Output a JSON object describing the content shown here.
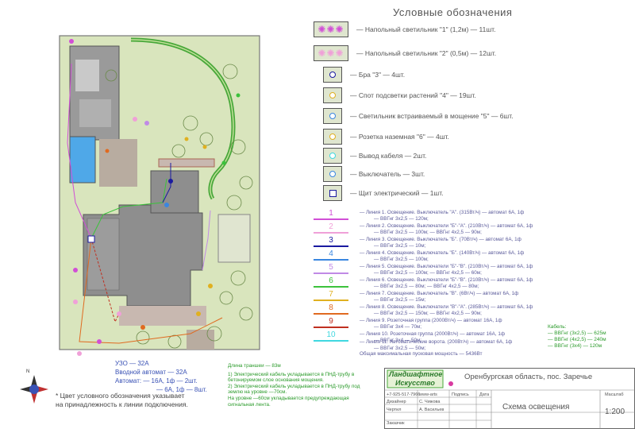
{
  "legend": {
    "title": "Условные обозначения",
    "items": [
      {
        "label": "— Напольный светильник \"1\" (1,2м) — 11шт.",
        "icon": "floor-lamp-1-icon"
      },
      {
        "label": "— Напольный светильник \"2\" (0,5м) — 12шт.",
        "icon": "floor-lamp-2-icon"
      },
      {
        "label": "— Бра \"3\" — 4шт.",
        "icon": "wall-lamp-icon"
      },
      {
        "label": "— Спот подсветки растений \"4\" — 19шт.",
        "icon": "plant-spot-icon"
      },
      {
        "label": "— Светильник встраиваемый в мощение \"5\" — 6шт.",
        "icon": "inground-lamp-icon"
      },
      {
        "label": "— Розетка наземная \"6\" — 4шт.",
        "icon": "ground-socket-icon"
      },
      {
        "label": "— Вывод кабеля — 2шт.",
        "icon": "cable-outlet-icon"
      },
      {
        "label": "— Выключатель — 3шт.",
        "icon": "switch-icon"
      },
      {
        "label": "— Щит электрический — 1шт.",
        "icon": "electric-panel-icon"
      }
    ]
  },
  "lines": [
    {
      "num": "1",
      "color": "#d14fd6",
      "l1": "— Линия 1. Освещение. Выключатель \"А\". (315Вт/ч) — автомат 6А, 1ф",
      "l2": "— ВВГнг 3х2,5 — 120м;"
    },
    {
      "num": "2",
      "color": "#f0a0d8",
      "l1": "— Линия 2. Освещение. Выключатели \"Б\"-\"А\". (210Вт/ч) — автомат 6А, 1ф",
      "l2": "— ВВГнг 3х2,5 — 100м; — ВВГнг 4х2,5 — 90м;"
    },
    {
      "num": "3",
      "color": "#1a1aa0",
      "l1": "— Линия 3. Освещение. Выключатель \"Б\". (70Вт/ч) — автомат 6А, 1ф",
      "l2": "— ВВГнг 3х2,5 — 10м;"
    },
    {
      "num": "4",
      "color": "#3a86e0",
      "l1": "— Линия 4. Освещение. Выключатель \"Б\". (140Вт/ч) — автомат 6А, 1ф",
      "l2": "— ВВГнг 3х2,5 — 100м;"
    },
    {
      "num": "5",
      "color": "#c08ae6",
      "l1": "— Линия 5. Освещение. Выключатели \"Б\"-\"В\". (210Вт/ч) — автомат 6А, 1ф",
      "l2": "— ВВГнг 3х2,5 — 100м; — ВВГнг 4х2,5 — 60м;"
    },
    {
      "num": "6",
      "color": "#3cc23c",
      "l1": "— Линия 6. Освещение. Выключатели \"Б\"-\"В\". (210Вт/ч) — автомат 6А, 1ф",
      "l2": "— ВВГнг 3х2,5 — 80м; — ВВГнг 4х2,5 — 80м;"
    },
    {
      "num": "7",
      "color": "#e0b020",
      "l1": "— Линия 7. Освещение. Выключатель \"В\". (6Вт/ч) — автомат 6А, 1ф",
      "l2": "— ВВГнг 3х2,5 — 15м;"
    },
    {
      "num": "8",
      "color": "#e06a20",
      "l1": "— Линия 8. Освещение. Выключатели \"В\"-\"А\". (285Вт/ч) — автомат 6А, 1ф",
      "l2": "— ВВГнг 3х2,5 — 150м; — ВВГнг 4х2,5 — 90м;"
    },
    {
      "num": "9",
      "color": "#c03020",
      "l1": "— Линия 9. Розеточная группа (2000Вт/ч) — автомат 16А, 1ф",
      "l2": "— ВВГнг 3х4 — 70м;"
    },
    {
      "num": "10",
      "color": "#40d8e0",
      "l1": "— Линия 10. Розеточная группа (2000Вт/ч) — автомат 16А, 1ф",
      "l2": "— ВВГнг 3х4 — 50м;"
    }
  ],
  "line11": "— Линия 11. Автоматические ворота. (200Вт/ч) — автомат 6А, 1ф",
  "line11b": "— ВВГнг 3х2,5 — 50м;",
  "total_power": "Общая максимальная пусковая мощность — 5436Вт",
  "cables": {
    "title": "Кабель:",
    "items": [
      "— ВВГнг (3х2,5) — 625м",
      "— ВВГнг (4х2,5) — 240м",
      "— ВВГнг (3х4) — 120м"
    ]
  },
  "specs": {
    "uzo": "УЗО — 32А",
    "intro": "Вводной автомат — 32А",
    "auto1": "Автомат:  — 16А, 1ф — 2шт.",
    "auto2": "— 6А, 1ф — 8шт."
  },
  "notes": {
    "trench": "Длина траншеи — 83м",
    "n1": "1) Электрический кабель укладывается в ПНД-трубу в бетонируемом слое основания мощения.",
    "n2": "2) Электрический кабель укладывается в ПНД-трубу под землю на уровне —70см.",
    "n3": "На уровне —60см укладывается предупреждающая сигнальная лента."
  },
  "color_note": "* Цвет условного обозначения указывает на принадлежность к линии подключения.",
  "compass": {
    "north": "N"
  },
  "stamp": {
    "logo_line1": "Ландшафтное",
    "logo_line2": "Искусство",
    "location": "Оренбургская область, пос. Заречье",
    "phone": "+7-925-517-7966",
    "site": "www-arts",
    "sign_label": "Подпись",
    "date_label": "Дата",
    "designer_label": "Дизайнер",
    "designer_name": "С. Чижова",
    "drafter_label": "Чертил",
    "drafter_name": "А. Васильев",
    "client_label": "Заказчик",
    "sheet_title": "Схема освещения",
    "scale_label": "Масштаб",
    "scale": "1:200"
  },
  "colors": {
    "lawn": "#d9e5bd",
    "path": "#48a83a",
    "house": "#8a8a8a",
    "paving": "#c8b8b0"
  }
}
